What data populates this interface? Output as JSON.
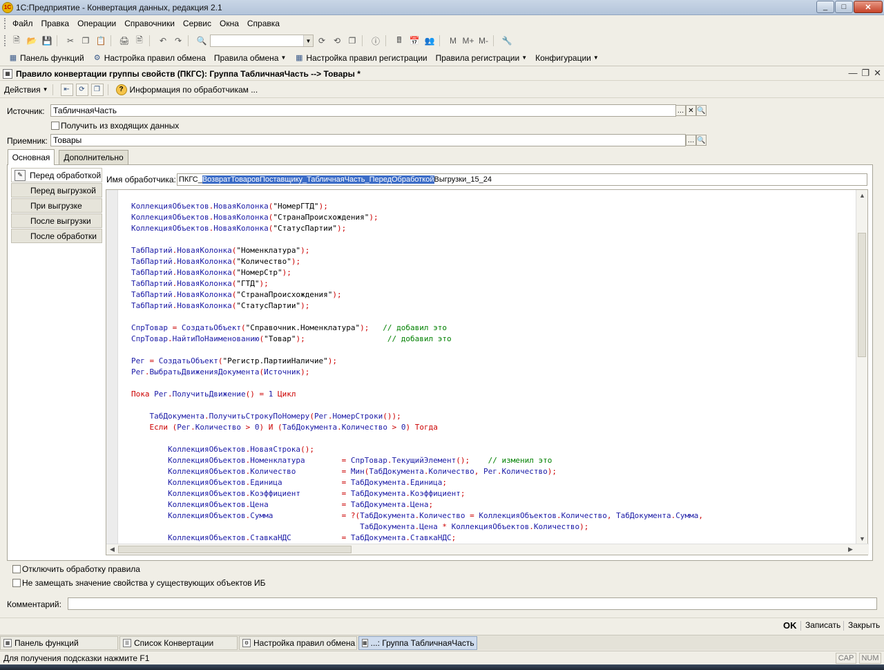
{
  "window": {
    "title": "1С:Предприятие - Конвертация данных, редакция 2.1",
    "app_icon": "1С"
  },
  "menu": [
    "Файл",
    "Правка",
    "Операции",
    "Справочники",
    "Сервис",
    "Окна",
    "Справка"
  ],
  "toolbar2": {
    "items": [
      {
        "label": "Панель функций",
        "icon": "function-panel-icon",
        "dropdown": false
      },
      {
        "label": "Настройка правил обмена",
        "icon": "gear-icon",
        "dropdown": false
      },
      {
        "label": "Правила обмена",
        "icon": "",
        "dropdown": true
      },
      {
        "label": "Настройка правил регистрации",
        "icon": "table-icon",
        "dropdown": false
      },
      {
        "label": "Правила регистрации",
        "icon": "",
        "dropdown": true
      },
      {
        "label": "Конфигурации",
        "icon": "",
        "dropdown": true
      }
    ]
  },
  "doc": {
    "title": "Правило конвертации группы свойств (ПКГС): Группа ТабличнаяЧасть --> Товары *",
    "actions_label": "Действия",
    "info_label": "Информация по обработчикам ..."
  },
  "form": {
    "source_label": "Источник:",
    "source_value": "ТабличнаяЧасть",
    "incoming_checkbox_label": "Получить из входящих данных",
    "target_label": "Приемник:",
    "target_value": "Товары"
  },
  "tabs": [
    "Основная",
    "Дополнительно"
  ],
  "handlers": [
    "Перед обработкой",
    "Перед выгрузкой",
    "При выгрузке",
    "После выгрузки",
    "После обработки"
  ],
  "handler_name": {
    "label": "Имя обработчика:",
    "prefix": "ПКГС_",
    "selected": "ВозвратТоваровПоставщику_ТабличнаяЧасть_ПередОбработкой",
    "suffix": "Выгрузки_15_24"
  },
  "code_lines": [
    "КоллекцияОбъектов.НоваяКолонка(\"НомерГТД\");",
    "КоллекцияОбъектов.НоваяКолонка(\"СтранаПроисхождения\");",
    "КоллекцияОбъектов.НоваяКолонка(\"СтатусПартии\");",
    "",
    "ТабПартий.НоваяКолонка(\"Номенклатура\");",
    "ТабПартий.НоваяКолонка(\"Количество\");",
    "ТабПартий.НоваяКолонка(\"НомерСтр\");",
    "ТабПартий.НоваяКолонка(\"ГТД\");",
    "ТабПартий.НоваяКолонка(\"СтранаПроисхождения\");",
    "ТабПартий.НоваяКолонка(\"СтатусПартии\");",
    "",
    "СпрТовар = СоздатьОбъект(\"Справочник.Номенклатура\");   // добавил это",
    "СпрТовар.НайтиПоНаименованию(\"Товар\");                  // добавил это",
    "",
    "Рег = СоздатьОбъект(\"Регистр.ПартииНаличие\");",
    "Рег.ВыбратьДвиженияДокумента(Источник);",
    "",
    "Пока Рег.ПолучитьДвижение() = 1 Цикл",
    "",
    "    ТабДокумента.ПолучитьСтрокуПоНомеру(Рег.НомерСтроки());",
    "    Если (Рег.Количество > 0) И (ТабДокумента.Количество > 0) Тогда",
    "",
    "        КоллекцияОбъектов.НоваяСтрока();",
    "        КоллекцияОбъектов.Номенклатура        = СпрТовар.ТекущийЭлемент();    // изменил это",
    "        КоллекцияОбъектов.Количество          = Мин(ТабДокумента.Количество, Рег.Количество);",
    "        КоллекцияОбъектов.Единица             = ТабДокумента.Единица;",
    "        КоллекцияОбъектов.Коэффициент         = ТабДокумента.Коэффициент;",
    "        КоллекцияОбъектов.Цена                = ТабДокумента.Цена;",
    "        КоллекцияОбъектов.Сумма               = ?(ТабДокумента.Количество = КоллекцияОбъектов.Количество, ТабДокумента.Сумма,",
    "                                                  ТабДокумента.Цена * КоллекцияОбъектов.Количество);",
    "        КоллекцияОбъектов.СтавкаНДС           = ТабДокумента.СтавкаНДС;"
  ],
  "code_colors": {
    "identifier": "#1a1aa6",
    "string": "#000000",
    "keyword": "#cc0000",
    "comment": "#008000",
    "operator": "#cc0000"
  },
  "options": {
    "disable_rule_label": "Отключить обработку правила",
    "no_replace_label": "Не замещать значение свойства у существующих объектов ИБ",
    "comment_label": "Комментарий:",
    "comment_value": ""
  },
  "buttons": {
    "ok": "OK",
    "save": "Записать",
    "close": "Закрыть"
  },
  "window_list": [
    "Панель функций",
    "Список Конвертации",
    "Настройка правил обмена",
    "...: Группа ТабличнаяЧасть ..."
  ],
  "status": {
    "hint": "Для получения подсказки нажмите F1",
    "cap": "CAP",
    "num": "NUM"
  }
}
